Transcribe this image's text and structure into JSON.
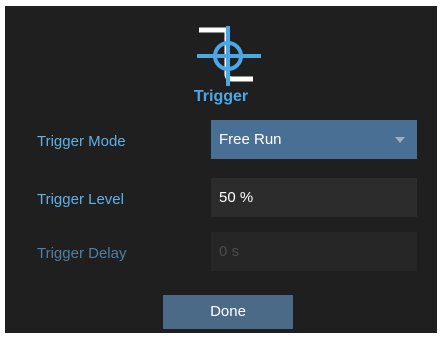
{
  "dialog": {
    "title": "Trigger",
    "icon": "trigger-icon",
    "accent_color": "#4aa8e6"
  },
  "fields": {
    "mode": {
      "label": "Trigger Mode",
      "value": "Free Run"
    },
    "level": {
      "label": "Trigger Level",
      "value": "50 %"
    },
    "delay": {
      "label": "Trigger Delay",
      "value": "0 s"
    }
  },
  "buttons": {
    "done_label": "Done"
  }
}
